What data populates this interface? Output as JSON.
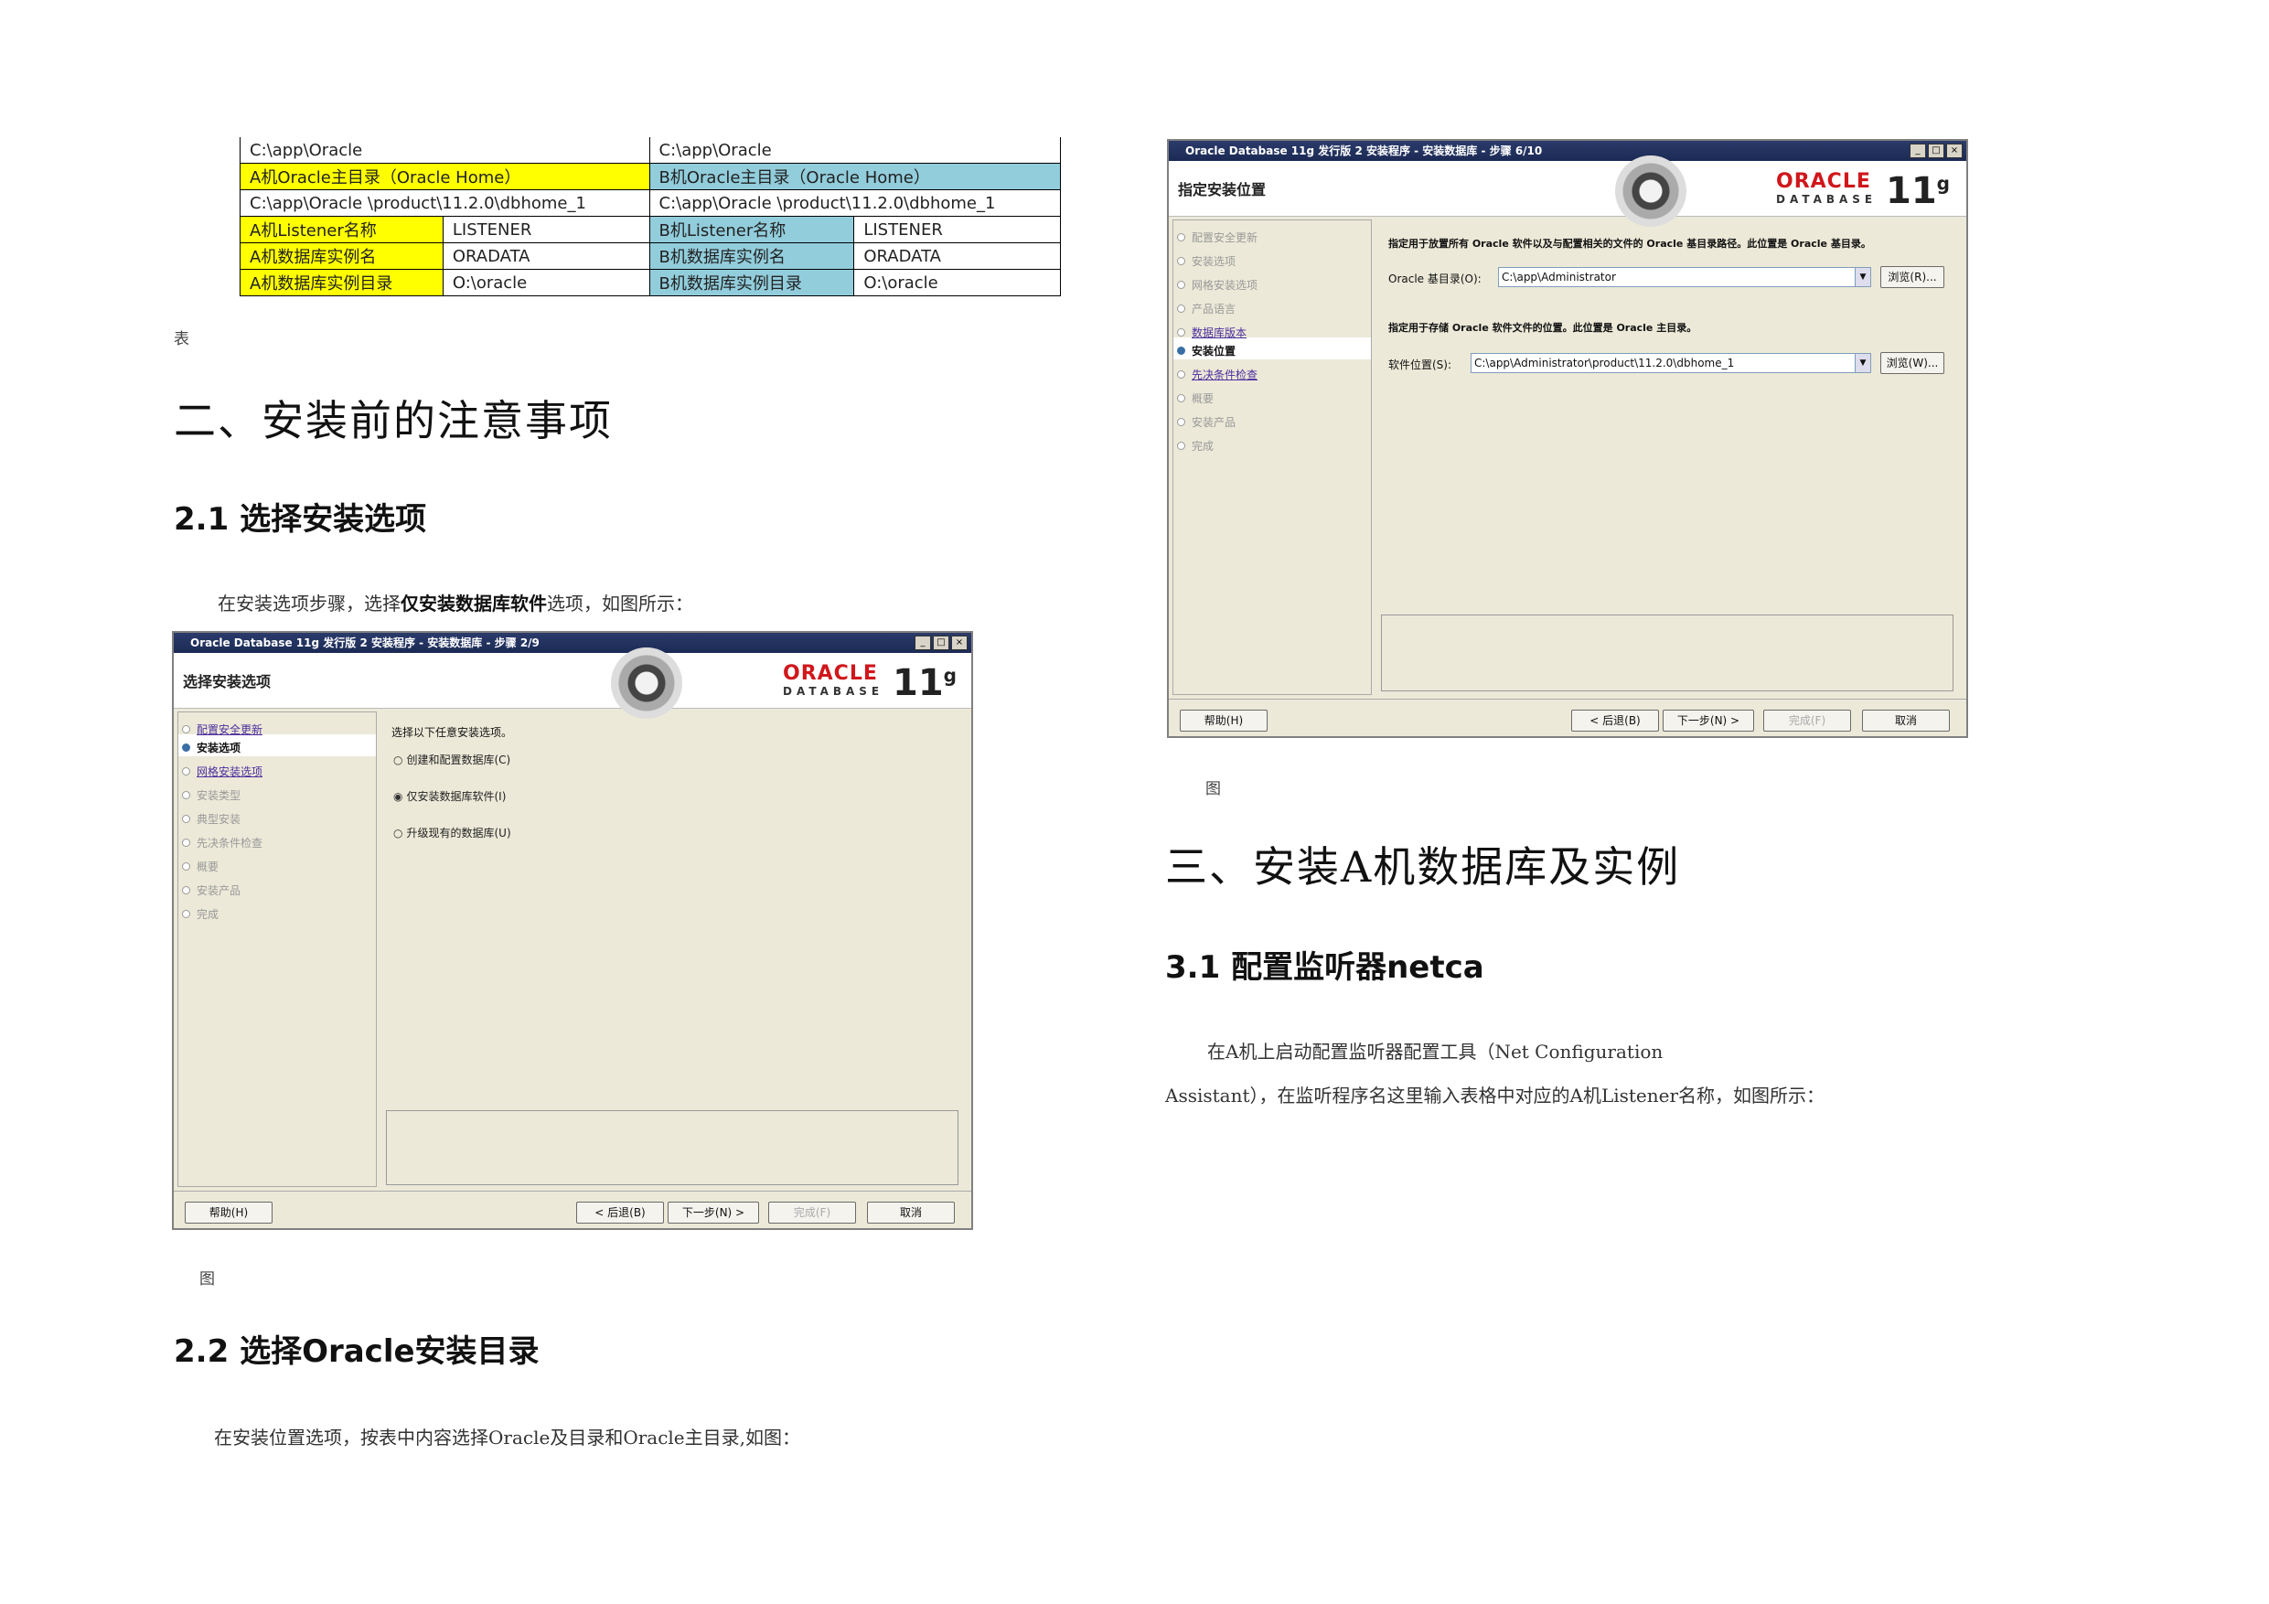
{
  "table": {
    "rows": [
      {
        "a_label": "C:\\app\\Oracle",
        "a_value": "",
        "b_label": "C:\\app\\Oracle",
        "b_value": "",
        "type": "path_root"
      },
      {
        "a_label": "A机Oracle主目录（Oracle Home）",
        "b_label": "B机Oracle主目录（Oracle Home）",
        "type": "home_header"
      },
      {
        "a_label": "C:\\app\\Oracle \\product\\11.2.0\\dbhome_1",
        "b_label": "C:\\app\\Oracle \\product\\11.2.0\\dbhome_1",
        "type": "home_path"
      },
      {
        "a_label": "A机Listener名称",
        "a_value": "LISTENER",
        "b_label": "B机Listener名称",
        "b_value": "LISTENER",
        "type": "kv"
      },
      {
        "a_label": "A机数据库实例名",
        "a_value": "ORADATA",
        "b_label": "B机数据库实例名",
        "b_value": "ORADATA",
        "type": "kv"
      },
      {
        "a_label": "A机数据库实例目录",
        "a_value": "O:\\oracle",
        "b_label": "B机数据库实例目录",
        "b_value": "O:\\oracle",
        "type": "kv"
      }
    ],
    "caption": "表"
  },
  "left": {
    "h1": "二、安装前的注意事项",
    "h2_1": "2.1 选择安装选项",
    "p1_a": "在安装选项步骤，选择",
    "p1_b": "仅安装数据库软件",
    "p1_c": "选项，如图所示：",
    "fig1_caption": "图",
    "h2_2": "2.2 选择Oracle安装目录",
    "p2": "在安装位置选项，按表中内容选择Oracle及目录和Oracle主目录,如图："
  },
  "right": {
    "fig2_caption": "图",
    "h1": "三、安装A机数据库及实例",
    "h2": "3.1 配置监听器netca",
    "p1": "在A机上启动配置监听器配置工具（Net Configuration",
    "p2": "Assistant），在监听程序名这里输入表格中对应的A机Listener名称，如图所示："
  },
  "oracle_logo": {
    "brand": "ORACLE",
    "sub": "DATABASE",
    "version": "11",
    "sup": "g"
  },
  "installer1": {
    "title": "Oracle Database 11g 发行版 2 安装程序 - 安装数据库 - 步骤 2/9",
    "heading": "选择安装选项",
    "steps": [
      {
        "label": "配置安全更新",
        "state": "link"
      },
      {
        "label": "安装选项",
        "state": "current"
      },
      {
        "label": "网格安装选项",
        "state": "link"
      },
      {
        "label": "安装类型",
        "state": "disabled"
      },
      {
        "label": "典型安装",
        "state": "disabled"
      },
      {
        "label": "先决条件检查",
        "state": "disabled"
      },
      {
        "label": "概要",
        "state": "disabled"
      },
      {
        "label": "安装产品",
        "state": "disabled"
      },
      {
        "label": "完成",
        "state": "disabled"
      }
    ],
    "prompt": "选择以下任意安装选项。",
    "options": [
      {
        "label": "创建和配置数据库(C)",
        "selected": false
      },
      {
        "label": "仅安装数据库软件(I)",
        "selected": true
      },
      {
        "label": "升级现有的数据库(U)",
        "selected": false
      }
    ],
    "buttons": {
      "help": "帮助(H)",
      "back": "< 后退(B)",
      "next": "下一步(N) >",
      "finish": "完成(F)",
      "cancel": "取消"
    }
  },
  "installer2": {
    "title": "Oracle Database 11g 发行版 2 安装程序 - 安装数据库 - 步骤 6/10",
    "heading": "指定安装位置",
    "steps": [
      {
        "label": "配置安全更新",
        "state": "disabled"
      },
      {
        "label": "安装选项",
        "state": "disabled"
      },
      {
        "label": "网格安装选项",
        "state": "disabled"
      },
      {
        "label": "产品语言",
        "state": "disabled"
      },
      {
        "label": "数据库版本",
        "state": "link"
      },
      {
        "label": "安装位置",
        "state": "current"
      },
      {
        "label": "先决条件检查",
        "state": "link"
      },
      {
        "label": "概要",
        "state": "disabled"
      },
      {
        "label": "安装产品",
        "state": "disabled"
      },
      {
        "label": "完成",
        "state": "disabled"
      }
    ],
    "base_desc": "指定用于放置所有 Oracle 软件以及与配置相关的文件的 Oracle 基目录路径。此位置是 Oracle 基目录。",
    "base_label": "Oracle 基目录(O):",
    "base_value": "C:\\app\\Administrator",
    "sw_desc": "指定用于存储 Oracle 软件文件的位置。此位置是 Oracle 主目录。",
    "sw_label": "软件位置(S):",
    "sw_value": "C:\\app\\Administrator\\product\\11.2.0\\dbhome_1",
    "browse1": "浏览(R)...",
    "browse2": "浏览(W)...",
    "buttons": {
      "help": "帮助(H)",
      "back": "< 后退(B)",
      "next": "下一步(N) >",
      "finish": "完成(F)",
      "cancel": "取消"
    }
  }
}
